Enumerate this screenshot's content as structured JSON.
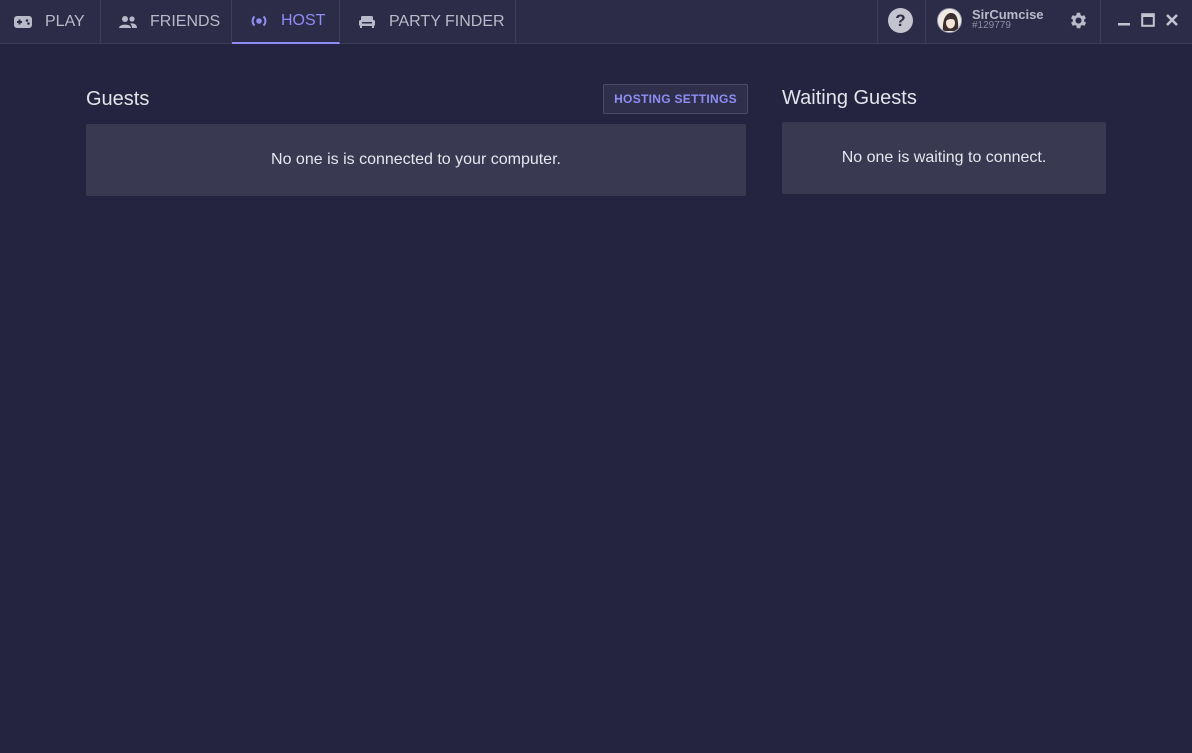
{
  "tabs": [
    {
      "label": "PLAY",
      "icon": "gamepad-icon"
    },
    {
      "label": "FRIENDS",
      "icon": "people-icon"
    },
    {
      "label": "HOST",
      "icon": "broadcast-icon"
    },
    {
      "label": "PARTY FINDER",
      "icon": "couch-icon"
    }
  ],
  "active_tab": "HOST",
  "user": {
    "name": "SirCumcise",
    "tag": "#129779"
  },
  "help_label": "?",
  "guests": {
    "title": "Guests",
    "settings_button": "HOSTING SETTINGS",
    "empty_message": "No one is is connected to your computer."
  },
  "waiting": {
    "title": "Waiting Guests",
    "empty_message": "No one is waiting to connect."
  },
  "colors": {
    "accent": "#8f8df3",
    "background": "#242440",
    "topbar": "#2c2c48",
    "panel": "#393951"
  }
}
